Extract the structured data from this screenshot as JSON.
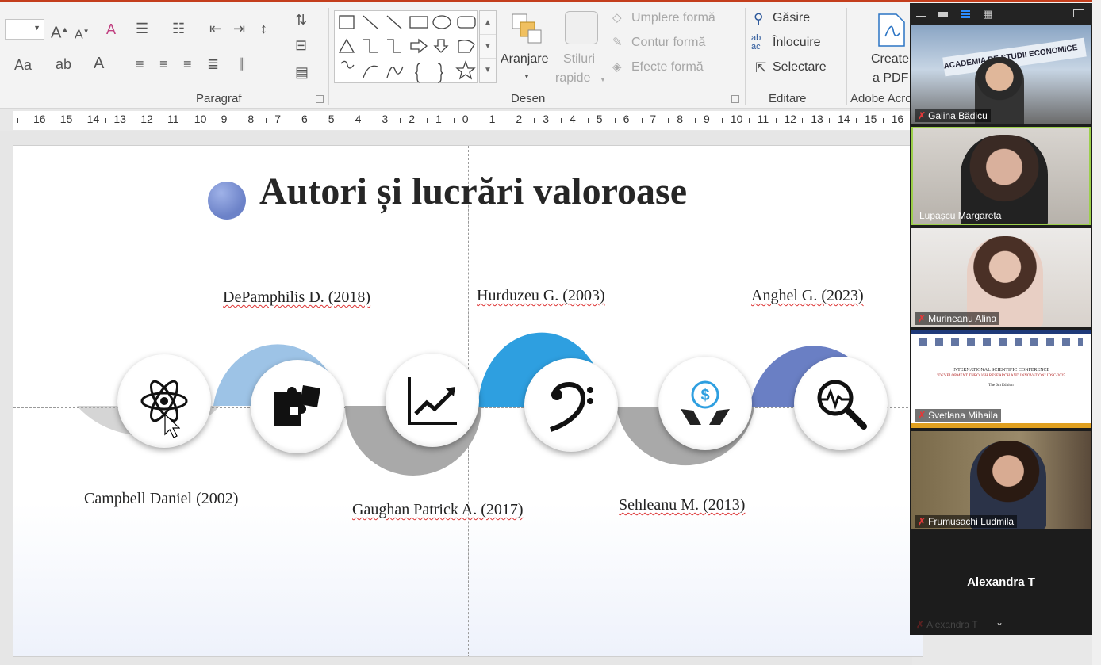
{
  "ribbon": {
    "font_size_value": "",
    "change_case_label": "Aa",
    "groups": {
      "paragraph_label": "Paragraf",
      "drawing_label": "Desen",
      "editing_label": "Editare",
      "adobe_label": "Adobe Acro"
    },
    "arrange_label": "Aranjare",
    "quick_styles_label_1": "Stiluri",
    "quick_styles_label_2": "rapide",
    "shape_fill_label": "Umplere formă",
    "shape_outline_label": "Contur formă",
    "shape_effects_label": "Efecte formă",
    "find_label": "Găsire",
    "replace_label": "Înlocuire",
    "select_label": "Selectare",
    "create_pdf_label_1": "Create",
    "create_pdf_label_2": "a PDF"
  },
  "ruler": {
    "labels": [
      "16",
      "15",
      "14",
      "13",
      "12",
      "11",
      "10",
      "9",
      "8",
      "7",
      "6",
      "5",
      "4",
      "3",
      "2",
      "1",
      "0",
      "1",
      "2",
      "3",
      "4",
      "5",
      "6",
      "7",
      "8",
      "9",
      "10",
      "11",
      "12",
      "13",
      "14",
      "15",
      "16"
    ]
  },
  "slide": {
    "title": "Autori și lucrări valoroase",
    "authors_top": [
      "DePamphilis D. (2018)",
      "Hurduzeu G. (2003)",
      "Anghel G. (2023)"
    ],
    "authors_bottom": [
      "Campbell Daniel (2002)",
      "Gaughan Patrick A. (2017)",
      "Sehleanu M. (2013)"
    ],
    "icons": [
      "atom-icon",
      "puzzle-icon",
      "chart-trend-icon",
      "bass-clef-icon",
      "money-hands-icon",
      "search-pulse-icon"
    ],
    "colors": {
      "arc_light_blue": "#9dc3e6",
      "arc_blue": "#2e9fe0",
      "arc_indigo": "#6a7fc4",
      "arc_gray": "#b3b3b3",
      "title_dot": "#6c82c8"
    }
  },
  "zoom": {
    "participants": [
      {
        "name": "Galina Bădicu",
        "muted": true
      },
      {
        "name": "Lupașcu Margareta",
        "muted": false
      },
      {
        "name": "Murineanu Alina",
        "muted": true
      },
      {
        "name": "Svetlana Mihaila",
        "muted": true
      },
      {
        "name": "Frumusachi Ludmila",
        "muted": true
      }
    ],
    "self_name": "Alexandra T",
    "self_sub": "Alexandra T",
    "shared_slide": {
      "line1": "INTERNATIONAL SCIENTIFIC CONFERENCE",
      "line2": "\"DEVELOPMENT THROUGH RESEARCH AND INNOVATION\" IDSC-2025",
      "line3": "The 6th Edition"
    },
    "building_sign": "ACADEMIA DE STUDII ECONOMICE"
  }
}
